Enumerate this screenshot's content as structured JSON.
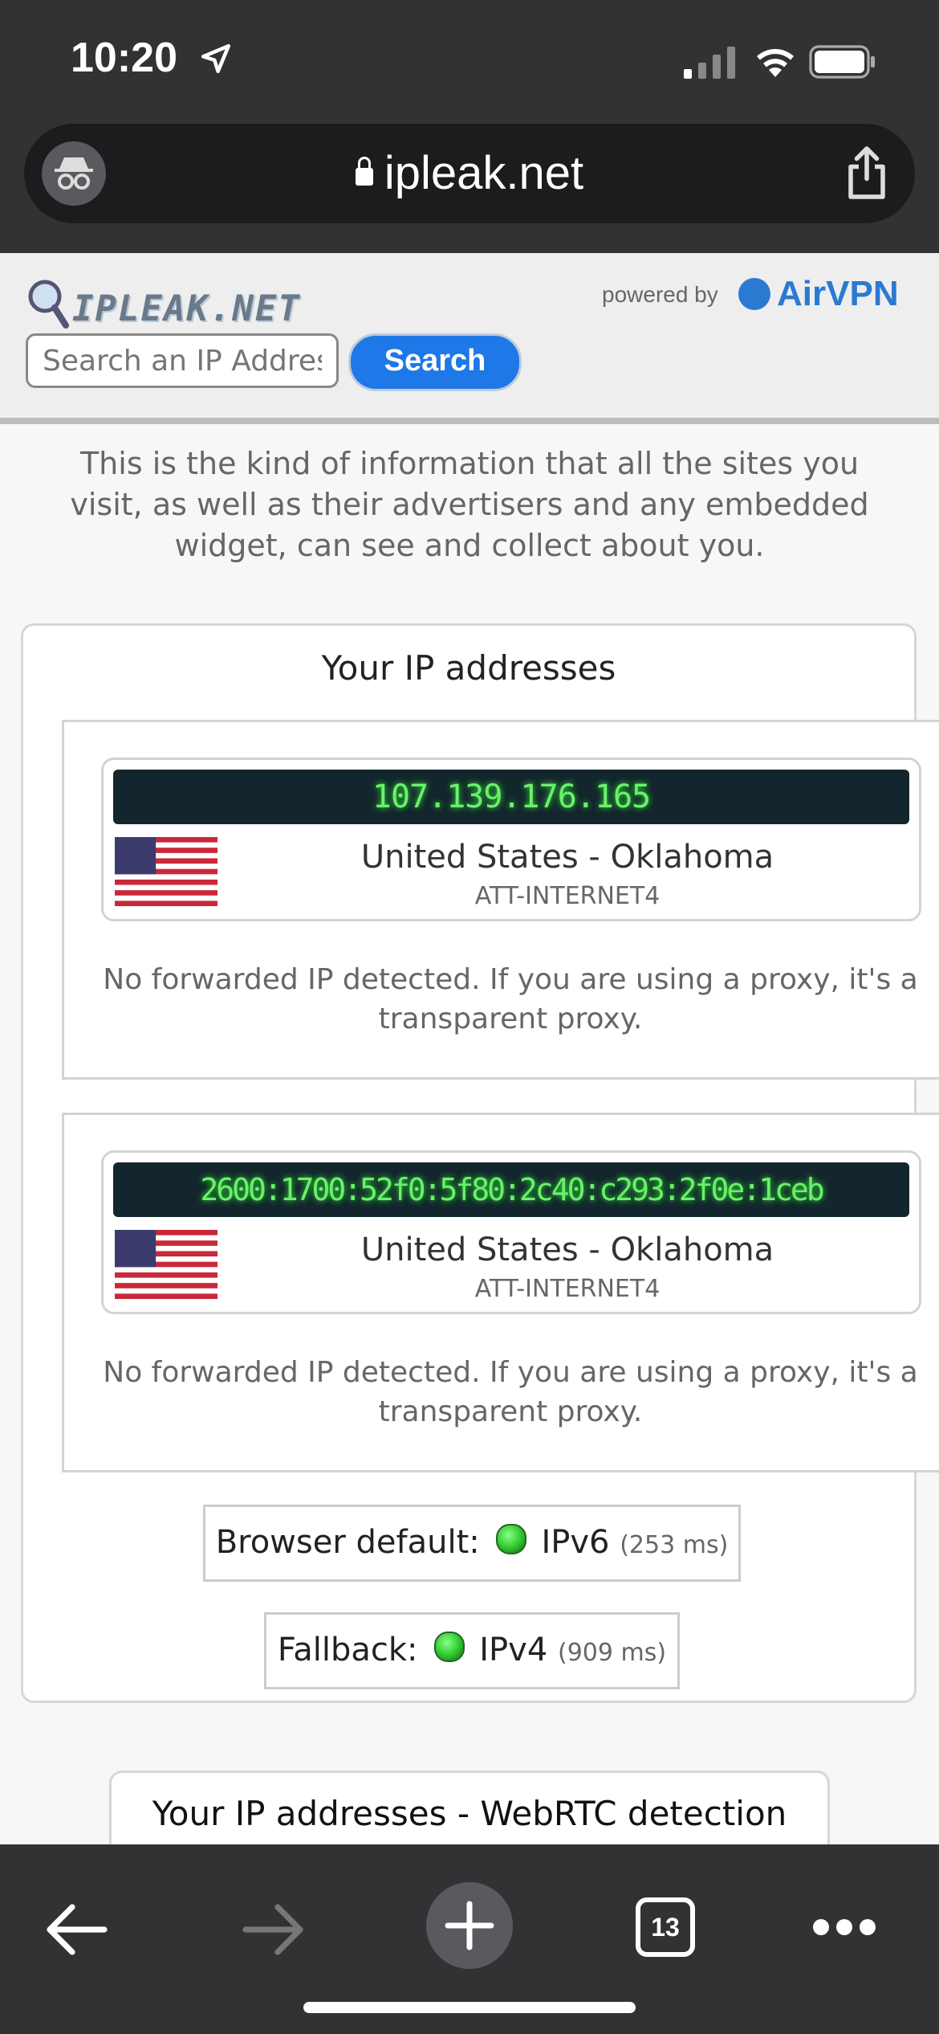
{
  "status_bar": {
    "time": "10:20"
  },
  "browser": {
    "url": "ipleak.net",
    "tab_count": "13"
  },
  "site": {
    "logo_text": "IPLEAK.NET",
    "powered_by": "powered by",
    "brand": "AirVPN",
    "search_placeholder": "Search an IP Address",
    "search_button": "Search",
    "intro": "This is the kind of information that all the sites you visit, as well as their advertisers and any embedded widget, can see and collect about you."
  },
  "ip_section": {
    "title": "Your IP addresses",
    "entries": [
      {
        "ip": "107.139.176.165",
        "location": "United States - Oklahoma",
        "isp": "ATT-INTERNET4",
        "note": "No forwarded IP detected. If you are using a proxy, it's a transparent proxy."
      },
      {
        "ip": "2600:1700:52f0:5f80:2c40:c293:2f0e:1ceb",
        "location": "United States - Oklahoma",
        "isp": "ATT-INTERNET4",
        "note": "No forwarded IP detected. If you are using a proxy, it's a transparent proxy."
      }
    ],
    "browser_default": {
      "label": "Browser default:",
      "protocol": "IPv6",
      "time": "(253 ms)",
      "status_color": "#33cc33"
    },
    "fallback": {
      "label": "Fallback:",
      "protocol": "IPv4",
      "time": "(909 ms)",
      "status_color": "#33cc33"
    }
  },
  "webrtc_section": {
    "title": "Your IP addresses - WebRTC detection"
  },
  "colors": {
    "accent": "#1e78e8",
    "ip_text": "#6cf06c",
    "ip_bg": "#13262d",
    "chrome": "#323235"
  }
}
